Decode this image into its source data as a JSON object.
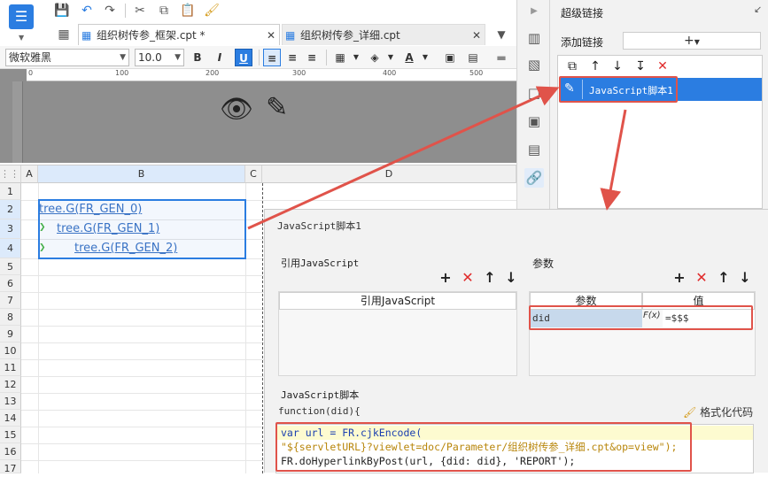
{
  "toolbar": {
    "icons": [
      "save-icon",
      "undo-icon",
      "redo-icon",
      "cut-icon",
      "copy-icon",
      "paste-icon",
      "format-brush-icon"
    ]
  },
  "tabs": [
    {
      "label": "组织树传参_框架.cpt *",
      "active": true
    },
    {
      "label": "组织树传参_详细.cpt",
      "active": false
    }
  ],
  "format": {
    "font_name": "微软雅黑",
    "font_size": "10.0",
    "bold": "B",
    "italic": "I",
    "underline": "U"
  },
  "ruler": {
    "ticks": [
      "0",
      "100",
      "200",
      "300",
      "400",
      "500"
    ]
  },
  "grid": {
    "columns": [
      "A",
      "B",
      "C",
      "D"
    ],
    "rows": [
      "1",
      "2",
      "3",
      "4",
      "5",
      "6",
      "7",
      "8",
      "9",
      "10",
      "11",
      "12",
      "13",
      "14",
      "15",
      "16",
      "17"
    ],
    "cells": [
      "tree.G(FR_GEN_0)",
      "tree.G(FR_GEN_1)",
      "tree.G(FR_GEN_2)"
    ]
  },
  "panel": {
    "title": "超级链接",
    "add_label": "添加链接",
    "add_symbol": "+",
    "selected_item": "JavaScript脚本1"
  },
  "dialog": {
    "title": "JavaScript脚本1",
    "ref_group": "引用JavaScript",
    "ref_column": "引用JavaScript",
    "param_group": "参数",
    "param_columns": [
      "参数",
      "值"
    ],
    "param_row": {
      "name": "did",
      "formula_symbol": "F(x)",
      "value": "=$$$"
    },
    "script_group": "JavaScript脚本",
    "function_sig": "function(did){",
    "format_code": "格式化代码",
    "code": [
      "var url = FR.cjkEncode(",
      "\"${servletURL}?viewlet=doc/Parameter/组织树传参_详细.cpt&op=view\");",
      "FR.doHyperlinkByPost(url, {did: did}, 'REPORT');"
    ]
  },
  "colors": {
    "accent": "#2b7de1",
    "highlight": "#e0534a",
    "delete": "#e02b2b"
  }
}
